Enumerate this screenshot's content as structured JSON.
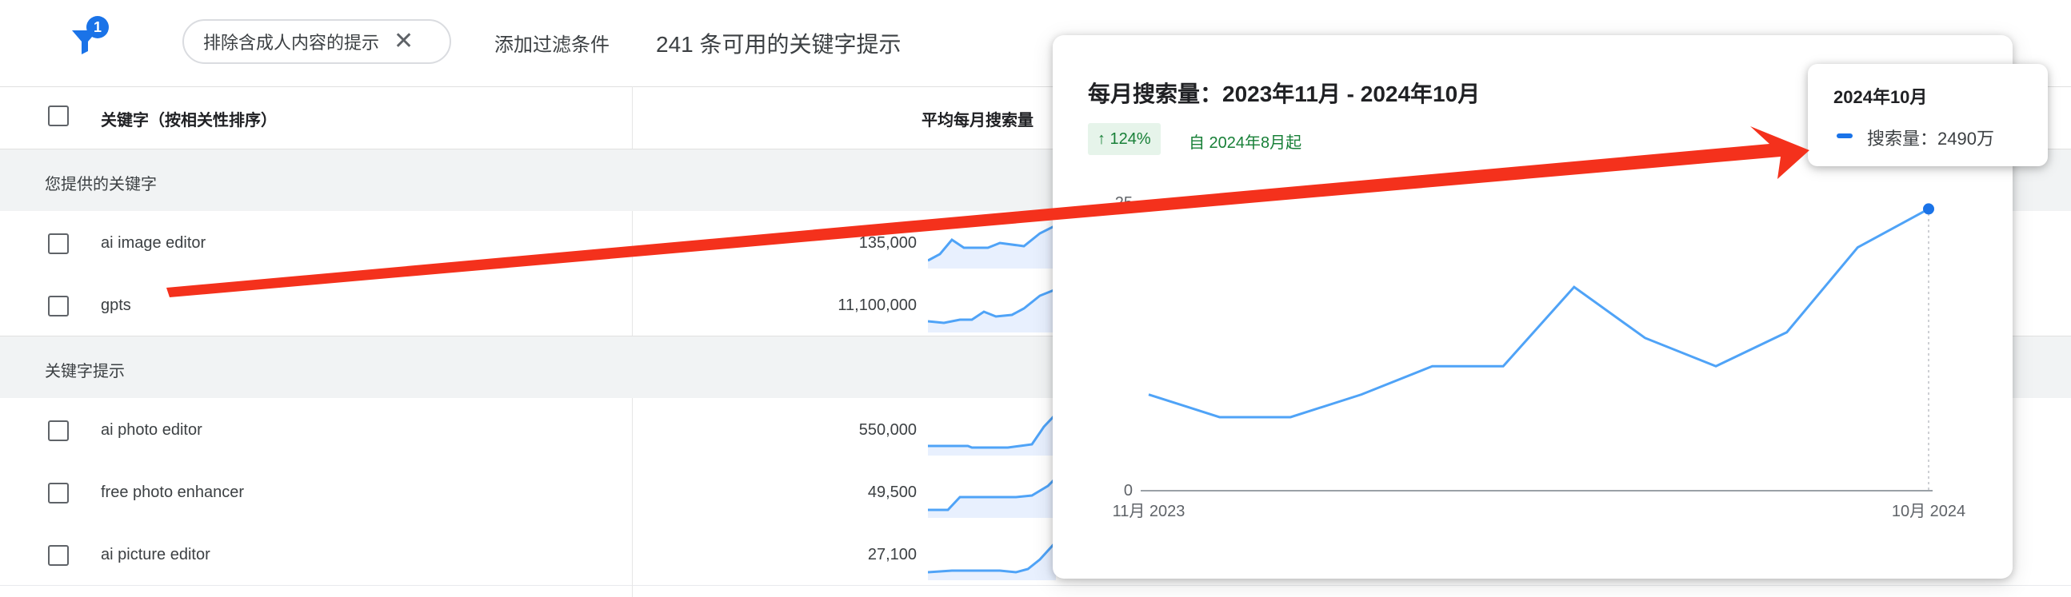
{
  "toolbar": {
    "filter_badge": "1",
    "chip_label": "排除含成人内容的提示",
    "chip_close": "✕",
    "add_filter": "添加过滤条件",
    "available_count": "241 条可用的关键字提示"
  },
  "table": {
    "header_keyword": "关键字（按相关性排序）",
    "header_avg": "平均每月搜索量",
    "sections": [
      {
        "label": "您提供的关键字",
        "rows": [
          {
            "keyword": "ai image editor",
            "volume": "135,000"
          },
          {
            "keyword": "gpts",
            "volume": "11,100,000"
          }
        ]
      },
      {
        "label": "关键字提示",
        "rows": [
          {
            "keyword": "ai photo editor",
            "volume": "550,000"
          },
          {
            "keyword": "free photo enhancer",
            "volume": "49,500"
          },
          {
            "keyword": "ai picture editor",
            "volume": "27,100"
          }
        ]
      }
    ]
  },
  "popup": {
    "title": "每月搜索量：2023年11月 - 2024年10月",
    "trend": "↑ 124%",
    "since": "自 2024年8月起",
    "tooltip_title": "2024年10月",
    "tooltip_text": "搜索量：2490万"
  },
  "chart_data": {
    "type": "line",
    "x": [
      "2023-11",
      "2023-12",
      "2024-01",
      "2024-02",
      "2024-03",
      "2024-04",
      "2024-05",
      "2024-06",
      "2024-07",
      "2024-08",
      "2024-09",
      "2024-10"
    ],
    "series": [
      {
        "name": "搜索量",
        "values": [
          8.5,
          6.5,
          6.5,
          8.5,
          11.0,
          11.0,
          18.0,
          13.5,
          11.0,
          14.0,
          21.5,
          24.9
        ]
      }
    ],
    "y_tick_labels": [
      "0",
      "25"
    ],
    "x_tick_labels": [
      "11月 2023",
      "10月 2024"
    ],
    "ylim": [
      0,
      25
    ],
    "color": "#4fa3f7"
  },
  "colors": {
    "accent": "#1a73e8",
    "arrow": "#f4311c",
    "trend_green": "#188038"
  }
}
